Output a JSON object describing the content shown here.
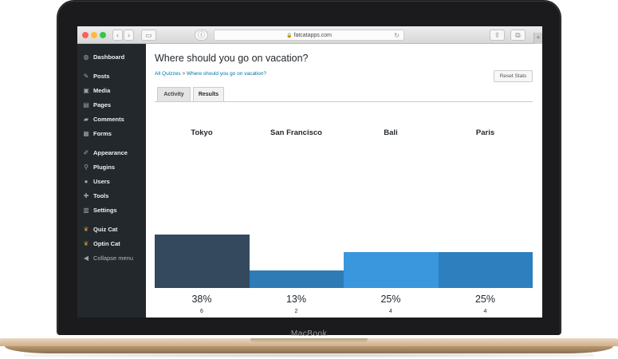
{
  "device": {
    "brand": "MacBook"
  },
  "browser": {
    "address": "fatcatapps.com",
    "nav_back": "‹",
    "nav_forward": "›",
    "sidebar_toggle": "▭",
    "info_icon": "ⓘ",
    "lock_icon": "🔒",
    "reload_icon": "↻",
    "share_icon": "⇪",
    "tabs_icon": "⧉",
    "new_tab": "+"
  },
  "sidebar": {
    "items": [
      {
        "label": "Dashboard",
        "icon": "◍"
      },
      {
        "label": "Posts",
        "icon": "✎"
      },
      {
        "label": "Media",
        "icon": "▣"
      },
      {
        "label": "Pages",
        "icon": "▤"
      },
      {
        "label": "Comments",
        "icon": "▰"
      },
      {
        "label": "Forms",
        "icon": "▦"
      },
      {
        "label": "Appearance",
        "icon": "✐"
      },
      {
        "label": "Plugins",
        "icon": "⚲"
      },
      {
        "label": "Users",
        "icon": "●"
      },
      {
        "label": "Tools",
        "icon": "✚"
      },
      {
        "label": "Settings",
        "icon": "▥"
      },
      {
        "label": "Quiz Cat",
        "icon": "❦"
      },
      {
        "label": "Optin Cat",
        "icon": "❦"
      },
      {
        "label": "Collapse menu",
        "icon": "◀"
      }
    ]
  },
  "main": {
    "title": "Where should you go on vacation?",
    "breadcrumb": {
      "root": "All Quizzes",
      "separator": ">",
      "current": "Where should you go on vacation?"
    },
    "reset_label": "Reset Stats",
    "tabs": [
      {
        "label": "Activity",
        "active": false
      },
      {
        "label": "Results",
        "active": true
      }
    ]
  },
  "chart_data": {
    "type": "bar",
    "categories": [
      "Tokyo",
      "San Francisco",
      "Bali",
      "Paris"
    ],
    "percent_labels": [
      "38%",
      "13%",
      "25%",
      "25%"
    ],
    "counts": [
      6,
      2,
      4,
      4
    ],
    "colors": [
      "#34495e",
      "#2e7bb6",
      "#3a96dd",
      "#2d80bd"
    ]
  }
}
